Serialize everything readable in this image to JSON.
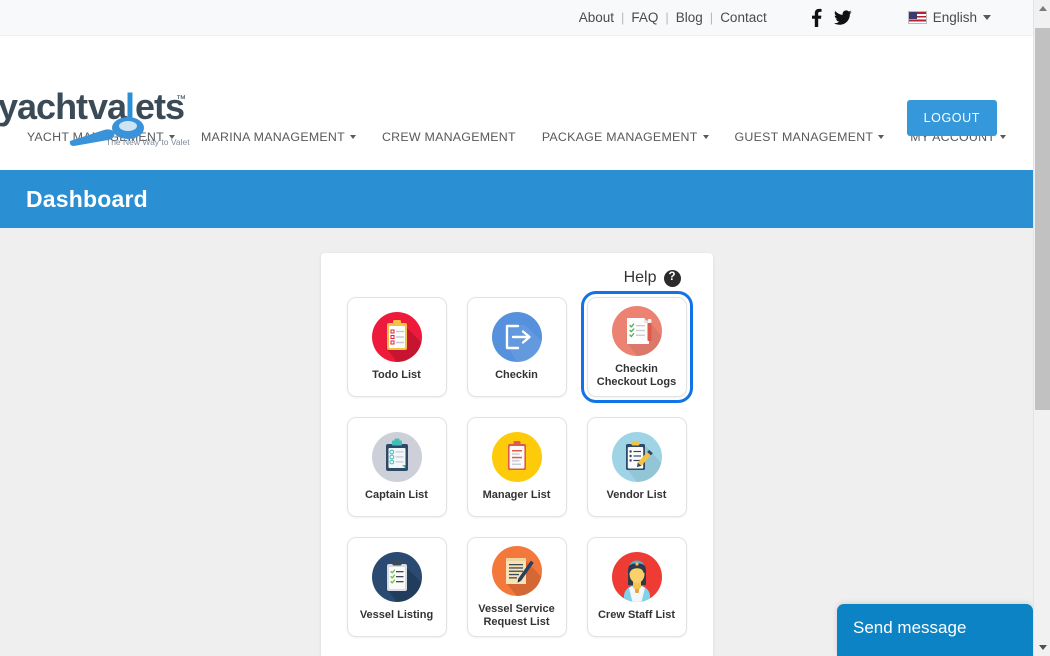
{
  "topbar": {
    "links": [
      {
        "label": "About"
      },
      {
        "label": "FAQ"
      },
      {
        "label": "Blog"
      },
      {
        "label": "Contact"
      }
    ],
    "separator": "|",
    "social": [
      {
        "name": "facebook-icon",
        "label": "Facebook"
      },
      {
        "name": "twitter-icon",
        "label": "Twitter"
      }
    ],
    "language": {
      "label": "English",
      "flag": "us-flag-icon",
      "caret": "chevron-down-icon"
    }
  },
  "header": {
    "logo": {
      "text": "yachtvalets",
      "trademark": "™",
      "tagline": "The New Way to Valet"
    },
    "logout_label": "LOGOUT"
  },
  "nav": {
    "items": [
      {
        "label": "YACHT MANAGEMENT",
        "has_caret": true
      },
      {
        "label": "MARINA MANAGEMENT",
        "has_caret": true
      },
      {
        "label": "CREW MANAGEMENT",
        "has_caret": false
      },
      {
        "label": "PACKAGE MANAGEMENT",
        "has_caret": true
      },
      {
        "label": "GUEST MANAGEMENT",
        "has_caret": true
      },
      {
        "label": "MY ACCOUNT",
        "has_caret": true
      }
    ]
  },
  "banner": {
    "title": "Dashboard"
  },
  "panel": {
    "help": {
      "label": "Help",
      "badge": "?"
    },
    "tiles": [
      {
        "label": "Todo List",
        "icon": "clipboard-checklist-red-icon",
        "selected": false
      },
      {
        "label": "Checkin",
        "icon": "login-arrow-blue-icon",
        "selected": false
      },
      {
        "label": "Checkin Checkout Logs",
        "icon": "document-checklist-coral-icon",
        "selected": true
      },
      {
        "label": "Captain List",
        "icon": "clipboard-navy-gray-icon",
        "selected": false
      },
      {
        "label": "Manager List",
        "icon": "clipboard-yellow-icon",
        "selected": false
      },
      {
        "label": "Vendor List",
        "icon": "clipboard-pencil-lightblue-icon",
        "selected": false
      },
      {
        "label": "Vessel Listing",
        "icon": "clipboard-navy-icon",
        "selected": false
      },
      {
        "label": "Vessel Service Request List",
        "icon": "document-pen-orange-icon",
        "selected": false
      },
      {
        "label": "Crew Staff List",
        "icon": "crew-person-red-icon",
        "selected": false
      }
    ]
  },
  "chat": {
    "label": "Send message"
  },
  "scrollbar": {
    "up_arrow": "scroll-up-arrow-icon",
    "down_arrow": "scroll-down-arrow-icon"
  },
  "colors": {
    "accent_blue": "#2b8fd4",
    "logout_blue": "#3498db",
    "focus_blue": "#1273e6",
    "chat_blue": "#0b83c4",
    "page_bg": "#efefef",
    "topbar_bg": "#f8f9fa"
  }
}
